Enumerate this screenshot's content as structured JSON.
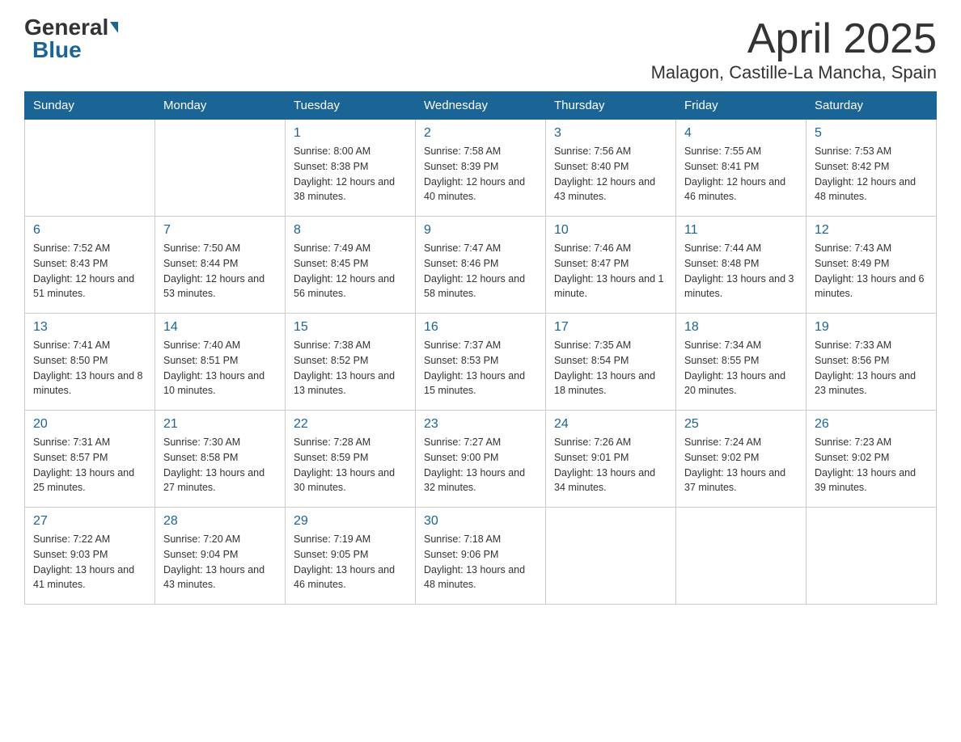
{
  "logo": {
    "general": "General",
    "blue": "Blue"
  },
  "title": "April 2025",
  "subtitle": "Malagon, Castille-La Mancha, Spain",
  "headers": [
    "Sunday",
    "Monday",
    "Tuesday",
    "Wednesday",
    "Thursday",
    "Friday",
    "Saturday"
  ],
  "weeks": [
    [
      {
        "day": "",
        "info": ""
      },
      {
        "day": "",
        "info": ""
      },
      {
        "day": "1",
        "info": "Sunrise: 8:00 AM\nSunset: 8:38 PM\nDaylight: 12 hours\nand 38 minutes."
      },
      {
        "day": "2",
        "info": "Sunrise: 7:58 AM\nSunset: 8:39 PM\nDaylight: 12 hours\nand 40 minutes."
      },
      {
        "day": "3",
        "info": "Sunrise: 7:56 AM\nSunset: 8:40 PM\nDaylight: 12 hours\nand 43 minutes."
      },
      {
        "day": "4",
        "info": "Sunrise: 7:55 AM\nSunset: 8:41 PM\nDaylight: 12 hours\nand 46 minutes."
      },
      {
        "day": "5",
        "info": "Sunrise: 7:53 AM\nSunset: 8:42 PM\nDaylight: 12 hours\nand 48 minutes."
      }
    ],
    [
      {
        "day": "6",
        "info": "Sunrise: 7:52 AM\nSunset: 8:43 PM\nDaylight: 12 hours\nand 51 minutes."
      },
      {
        "day": "7",
        "info": "Sunrise: 7:50 AM\nSunset: 8:44 PM\nDaylight: 12 hours\nand 53 minutes."
      },
      {
        "day": "8",
        "info": "Sunrise: 7:49 AM\nSunset: 8:45 PM\nDaylight: 12 hours\nand 56 minutes."
      },
      {
        "day": "9",
        "info": "Sunrise: 7:47 AM\nSunset: 8:46 PM\nDaylight: 12 hours\nand 58 minutes."
      },
      {
        "day": "10",
        "info": "Sunrise: 7:46 AM\nSunset: 8:47 PM\nDaylight: 13 hours\nand 1 minute."
      },
      {
        "day": "11",
        "info": "Sunrise: 7:44 AM\nSunset: 8:48 PM\nDaylight: 13 hours\nand 3 minutes."
      },
      {
        "day": "12",
        "info": "Sunrise: 7:43 AM\nSunset: 8:49 PM\nDaylight: 13 hours\nand 6 minutes."
      }
    ],
    [
      {
        "day": "13",
        "info": "Sunrise: 7:41 AM\nSunset: 8:50 PM\nDaylight: 13 hours\nand 8 minutes."
      },
      {
        "day": "14",
        "info": "Sunrise: 7:40 AM\nSunset: 8:51 PM\nDaylight: 13 hours\nand 10 minutes."
      },
      {
        "day": "15",
        "info": "Sunrise: 7:38 AM\nSunset: 8:52 PM\nDaylight: 13 hours\nand 13 minutes."
      },
      {
        "day": "16",
        "info": "Sunrise: 7:37 AM\nSunset: 8:53 PM\nDaylight: 13 hours\nand 15 minutes."
      },
      {
        "day": "17",
        "info": "Sunrise: 7:35 AM\nSunset: 8:54 PM\nDaylight: 13 hours\nand 18 minutes."
      },
      {
        "day": "18",
        "info": "Sunrise: 7:34 AM\nSunset: 8:55 PM\nDaylight: 13 hours\nand 20 minutes."
      },
      {
        "day": "19",
        "info": "Sunrise: 7:33 AM\nSunset: 8:56 PM\nDaylight: 13 hours\nand 23 minutes."
      }
    ],
    [
      {
        "day": "20",
        "info": "Sunrise: 7:31 AM\nSunset: 8:57 PM\nDaylight: 13 hours\nand 25 minutes."
      },
      {
        "day": "21",
        "info": "Sunrise: 7:30 AM\nSunset: 8:58 PM\nDaylight: 13 hours\nand 27 minutes."
      },
      {
        "day": "22",
        "info": "Sunrise: 7:28 AM\nSunset: 8:59 PM\nDaylight: 13 hours\nand 30 minutes."
      },
      {
        "day": "23",
        "info": "Sunrise: 7:27 AM\nSunset: 9:00 PM\nDaylight: 13 hours\nand 32 minutes."
      },
      {
        "day": "24",
        "info": "Sunrise: 7:26 AM\nSunset: 9:01 PM\nDaylight: 13 hours\nand 34 minutes."
      },
      {
        "day": "25",
        "info": "Sunrise: 7:24 AM\nSunset: 9:02 PM\nDaylight: 13 hours\nand 37 minutes."
      },
      {
        "day": "26",
        "info": "Sunrise: 7:23 AM\nSunset: 9:02 PM\nDaylight: 13 hours\nand 39 minutes."
      }
    ],
    [
      {
        "day": "27",
        "info": "Sunrise: 7:22 AM\nSunset: 9:03 PM\nDaylight: 13 hours\nand 41 minutes."
      },
      {
        "day": "28",
        "info": "Sunrise: 7:20 AM\nSunset: 9:04 PM\nDaylight: 13 hours\nand 43 minutes."
      },
      {
        "day": "29",
        "info": "Sunrise: 7:19 AM\nSunset: 9:05 PM\nDaylight: 13 hours\nand 46 minutes."
      },
      {
        "day": "30",
        "info": "Sunrise: 7:18 AM\nSunset: 9:06 PM\nDaylight: 13 hours\nand 48 minutes."
      },
      {
        "day": "",
        "info": ""
      },
      {
        "day": "",
        "info": ""
      },
      {
        "day": "",
        "info": ""
      }
    ]
  ]
}
